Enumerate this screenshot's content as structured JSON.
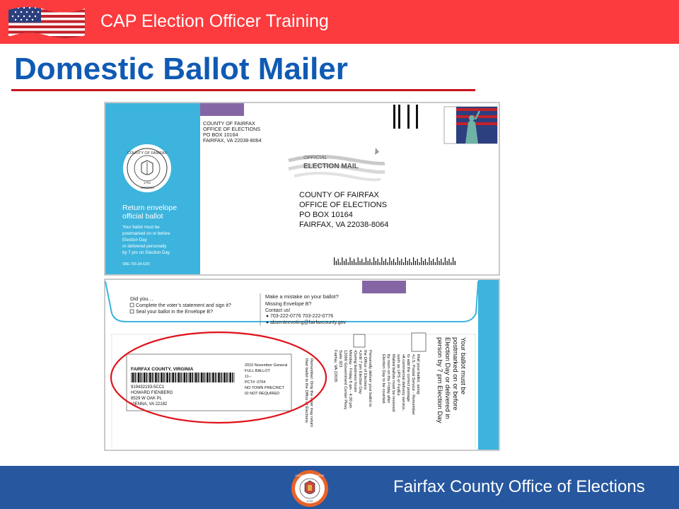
{
  "header": {
    "title": "CAP Election Officer Training"
  },
  "page": {
    "title": "Domestic Ballot Mailer"
  },
  "mailer": {
    "envelope": {
      "return_address": [
        "COUNTY OF FAIRFAX",
        "OFFICE OF ELECTIONS",
        "PO BOX 10164",
        "FAIRFAX, VA 22038-8064"
      ],
      "official_mail": [
        "OFFICIAL",
        "ELECTION MAIL"
      ],
      "mailing_address": [
        "COUNTY OF FAIRFAX",
        "OFFICE OF ELECTIONS",
        "PO BOX 10164",
        "FAIRFAX, VA 22038-8064"
      ],
      "left_panel": {
        "seal_text": "COUNTY OF FAIRFAX",
        "seal_year": "1742",
        "seal_state": "VIRGINIA",
        "heading": [
          "Return envelope",
          "official ballot"
        ],
        "body": [
          "Your ballot must be",
          "postmarked on or before",
          "Election Day",
          "or delivered personally",
          "by 7 pm on Election Day"
        ],
        "code": "SBE-706-3A 6/20"
      }
    },
    "flap": {
      "did_you_title": "Did you…",
      "did_you_items": [
        "Complete the voter’s statement and sign it?",
        "Seal your ballot in the Envelope B?"
      ],
      "mistake_lines": [
        "Make a mistake on your ballot?",
        "Missing Envelope B?",
        "Contact us!"
      ],
      "phones": "703-222-0776   703-222-0776",
      "email": "absenteevoting@fairfaxcounty.gov",
      "label": {
        "county": "FAIRFAX COUNTY, VIRGINIA",
        "voter": [
          "919432193-5CC1",
          "HOWARD FIENBERG",
          "8529 W OAK PL",
          "VIENNA, VA  22182"
        ],
        "ballot": [
          "2010 November General",
          "FULL BALLOT",
          "11--",
          "PCT#: 0704",
          "NO TOWN PRECINCT",
          "ID NOT REQUIRED"
        ]
      },
      "rotated_heading": [
        "Your ballot must be",
        "postmarked on or before",
        "Election Day or delivered in",
        "person by 7 pm Election Day"
      ],
      "rotated_mail": [
        "Mail your ballot, using:",
        "•U.S. Postal Service - Remember",
        "  to add the correct postage",
        "•A commercial delivery service,",
        "  such as UPS or FedEx",
        "Mailed ballots must be received",
        "by noon on the Friday after",
        "Election Day to be counted."
      ],
      "rotated_deliver": [
        "Personally deliver your ballot to",
        "the Office of Elections",
        "•Until 7 pm Election Day",
        "•During business hours",
        "  Monday - Friday 8 am - 4:30 pm",
        "  12000 Government Center Pkwy",
        "  Suite 323",
        "  Fairfax, VA 22035"
      ],
      "rotated_remember": [
        "Remember: Only the voter may return",
        "their ballot to the Office of Elections"
      ]
    }
  },
  "footer": {
    "org": "Fairfax County Office of Elections",
    "seal_text": "COUNTY OF FAIRFAX",
    "seal_year": "1742"
  },
  "colors": {
    "header_red": "#fb3b3e",
    "title_blue": "#0f5ab4",
    "rule_red": "#c8131a",
    "envelope_cyan": "#3cb4dd",
    "tab_purple": "#8566a5",
    "circle_red": "#e0121b",
    "footer_blue": "#27579f"
  }
}
